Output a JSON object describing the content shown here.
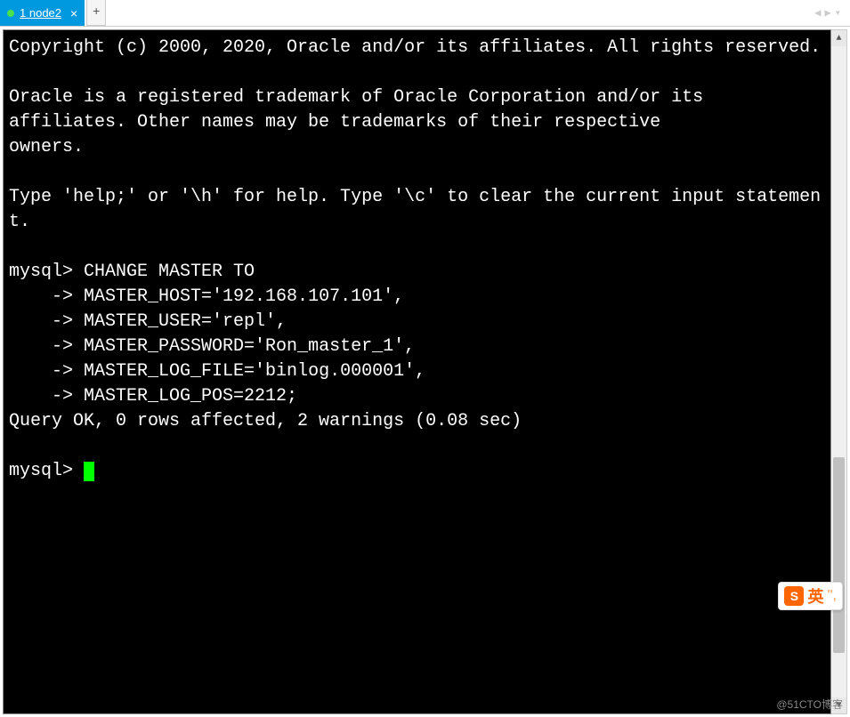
{
  "tab": {
    "index": "1",
    "label": "node2",
    "close": "×"
  },
  "new_tab": "+",
  "nav": {
    "left": "◀",
    "right": "▶",
    "menu": "▾"
  },
  "scroll": {
    "up": "▲",
    "down": "▼"
  },
  "terminal": {
    "lines": [
      "Copyright (c) 2000, 2020, Oracle and/or its affiliates. All rights reserved.",
      "",
      "Oracle is a registered trademark of Oracle Corporation and/or its",
      "affiliates. Other names may be trademarks of their respective",
      "owners.",
      "",
      "Type 'help;' or '\\h' for help. Type '\\c' to clear the current input statement.",
      "",
      "mysql> CHANGE MASTER TO",
      "    -> MASTER_HOST='192.168.107.101',",
      "    -> MASTER_USER='repl',",
      "    -> MASTER_PASSWORD='Ron_master_1',",
      "    -> MASTER_LOG_FILE='binlog.000001',",
      "    -> MASTER_LOG_POS=2212;",
      "Query OK, 0 rows affected, 2 warnings (0.08 sec)",
      "",
      "mysql> "
    ]
  },
  "ime": {
    "logo": "S",
    "char": "英",
    "dots": "'',"
  },
  "watermark": "@51CTO博客"
}
